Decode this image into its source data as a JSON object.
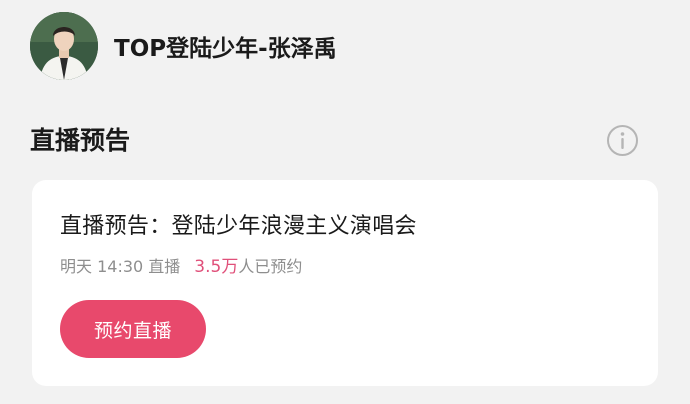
{
  "profile": {
    "name": "TOP登陆少年-张泽禹",
    "avatar_icon": "user-avatar"
  },
  "section": {
    "title": "直播预告",
    "info_icon": "info-circle-icon"
  },
  "preview_card": {
    "title": "直播预告：登陆少年浪漫主义演唱会",
    "schedule": "明天 14:30 直播",
    "reservation_count": "3.5万",
    "reservation_suffix": "人已预约",
    "reserve_button_label": "预约直播"
  },
  "colors": {
    "accent": "#e8496c",
    "count_highlight": "#e0507a",
    "page_background": "#f2f2f2",
    "card_background": "#ffffff",
    "muted_text": "#8e8e8e"
  }
}
